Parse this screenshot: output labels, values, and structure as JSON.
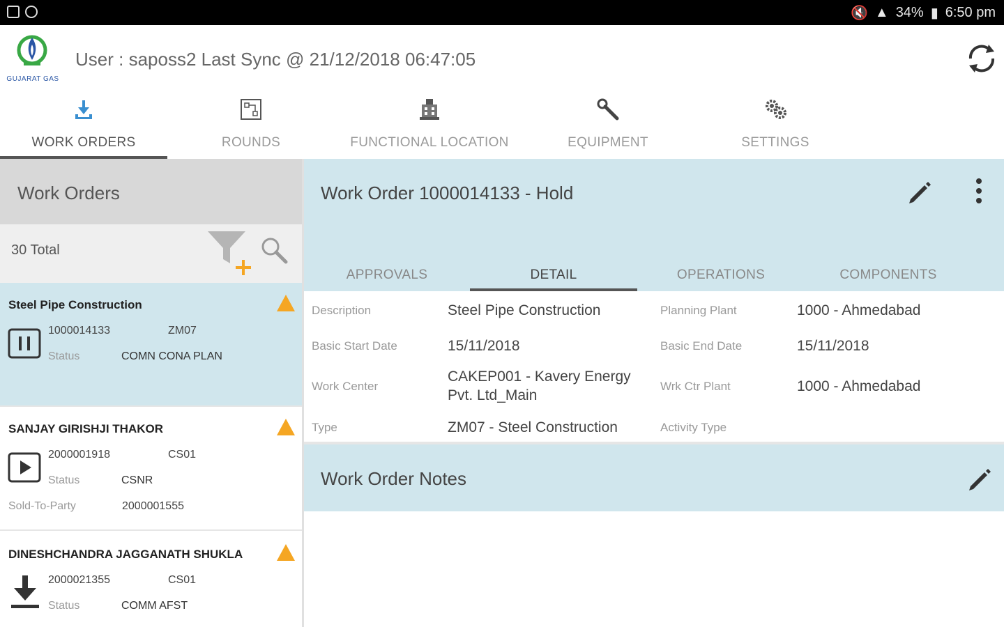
{
  "status_bar": {
    "battery": "34%",
    "time": "6:50 pm"
  },
  "header": {
    "logo_text": "GUJARAT GAS",
    "user_line": "User : saposs2 Last Sync @ 21/12/2018 06:47:05"
  },
  "tabs": [
    {
      "label": "WORK ORDERS",
      "icon": "download-icon",
      "active": true
    },
    {
      "label": "ROUNDS",
      "icon": "rounds-icon",
      "active": false
    },
    {
      "label": "FUNCTIONAL LOCATION",
      "icon": "building-icon",
      "active": false
    },
    {
      "label": "EQUIPMENT",
      "icon": "wrench-icon",
      "active": false
    },
    {
      "label": "SETTINGS",
      "icon": "gears-icon",
      "active": false
    }
  ],
  "work_orders_panel": {
    "title": "Work Orders",
    "total": "30 Total",
    "items": [
      {
        "title": "Steel Pipe Construction",
        "number": "1000014133",
        "code": "ZM07",
        "status_label": "Status",
        "status": "COMN CONA PLAN",
        "state_icon": "pause-icon",
        "selected": true
      },
      {
        "title": "SANJAY GIRISHJI THAKOR",
        "number": "2000001918",
        "code": "CS01",
        "status_label": "Status",
        "status": "CSNR",
        "party_label": "Sold-To-Party",
        "party": "2000001555",
        "state_icon": "play-icon",
        "selected": false
      },
      {
        "title": "DINESHCHANDRA JAGGANATH SHUKLA",
        "number": "2000021355",
        "code": "CS01",
        "status_label": "Status",
        "status": "COMM AFST",
        "state_icon": "download-icon",
        "selected": false
      }
    ]
  },
  "detail_panel": {
    "title": "Work Order 1000014133 - Hold",
    "subtabs": [
      {
        "label": "APPROVALS",
        "active": false
      },
      {
        "label": "DETAIL",
        "active": true
      },
      {
        "label": "OPERATIONS",
        "active": false
      },
      {
        "label": "COMPONENTS",
        "active": false
      }
    ],
    "fields": {
      "description_label": "Description",
      "description": "Steel Pipe Construction",
      "planning_plant_label": "Planning Plant",
      "planning_plant": "1000 - Ahmedabad",
      "basic_start_label": "Basic Start Date",
      "basic_start": "15/11/2018",
      "basic_end_label": "Basic End Date",
      "basic_end": "15/11/2018",
      "work_center_label": "Work Center",
      "work_center_line1": "CAKEP001 - Kavery Energy",
      "work_center_line2": "Pvt. Ltd_Main",
      "wrk_ctr_plant_label": "Wrk Ctr Plant",
      "wrk_ctr_plant": "1000 - Ahmedabad",
      "type_label": "Type",
      "type": "ZM07 - Steel Construction",
      "activity_type_label": "Activity Type",
      "activity_type": ""
    },
    "notes_title": "Work Order Notes"
  },
  "colors": {
    "accent_panel": "#d0e6ed",
    "warning": "#f5a623",
    "plus": "#f5a623"
  }
}
